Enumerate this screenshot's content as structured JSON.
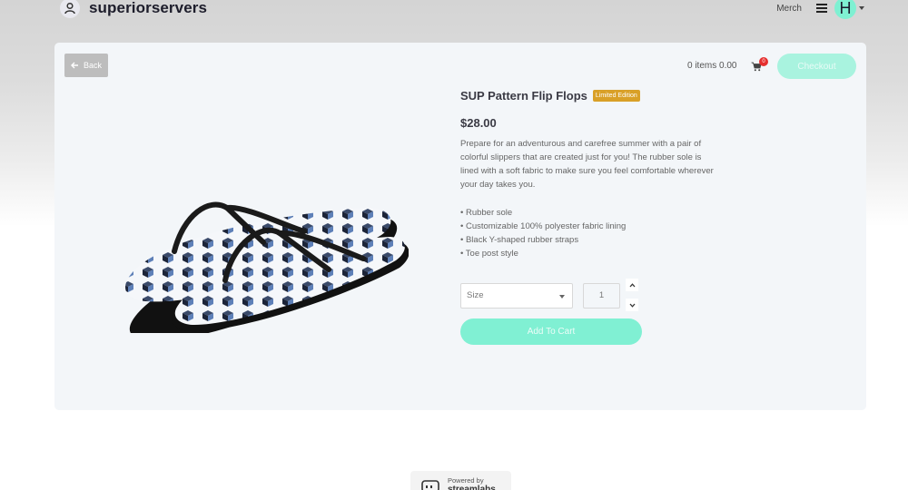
{
  "header": {
    "store_name": "superiorservers",
    "nav_merch": "Merch",
    "user_initial": "H"
  },
  "toolbar": {
    "back_label": "Back",
    "cart_summary": "0 items 0.00",
    "cart_count": "0",
    "checkout_label": "Checkout"
  },
  "product": {
    "title": "SUP Pattern Flip Flops",
    "badge": "Limited Edition",
    "price": "$28.00",
    "description": "Prepare for an adventurous and carefree summer with a pair of colorful slippers that are created just for you! The rubber sole is lined with a soft fabric to make sure you feel comfortable wherever your day takes you.",
    "features": [
      "• Rubber sole",
      "• Customizable 100% polyester fabric lining",
      "• Black Y-shaped rubber straps",
      "• Toe post style"
    ],
    "size_placeholder": "Size",
    "quantity": "1",
    "add_to_cart_label": "Add To Cart"
  },
  "footer": {
    "powered_by": "Powered by",
    "brand": "streamlabs"
  },
  "colors": {
    "accent": "#80f0d3",
    "badge": "#d9a027",
    "cart_badge": "#e62f2f"
  },
  "icons": {
    "brand": "user-circle-icon",
    "menu": "hamburger-icon",
    "back": "arrow-left-icon",
    "cart": "shopping-cart-icon"
  }
}
